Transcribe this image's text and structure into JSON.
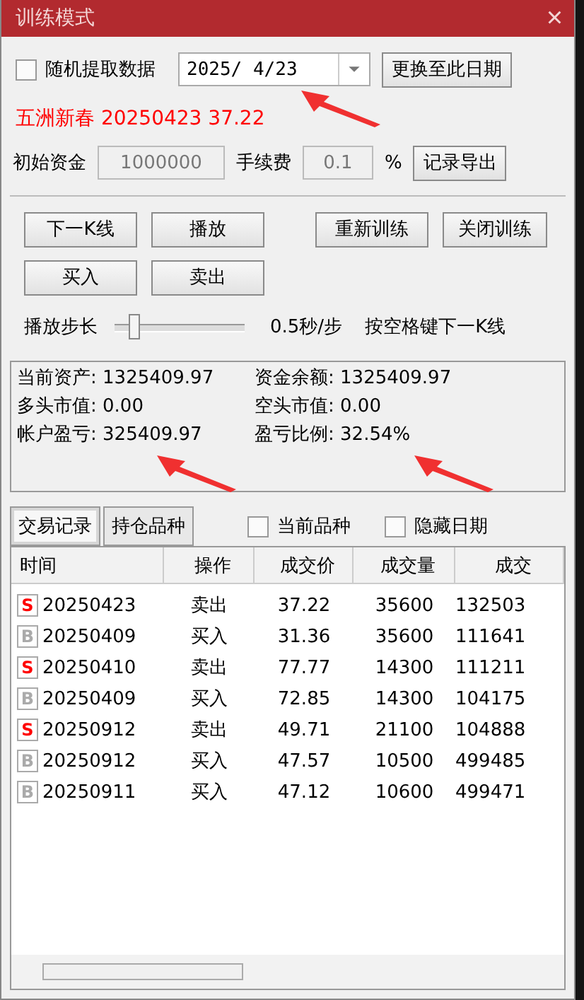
{
  "window": {
    "title": "训练模式",
    "close": "×"
  },
  "random_data": {
    "label": "随机提取数据",
    "checked": false
  },
  "date_field": {
    "value": "2025/ 4/23"
  },
  "change_date_button": "更换至此日期",
  "stock_line": "五洲新春 20250423 37.22",
  "initial_funds": {
    "label": "初始资金",
    "value": "1000000",
    "disabled": true
  },
  "fee": {
    "label": "手续费",
    "value": "0.1",
    "unit": "%",
    "disabled": true
  },
  "export_button": "记录导出",
  "buttons_row1": [
    "下一K线",
    "播放",
    "重新训练",
    "关闭训练"
  ],
  "buttons_row2": [
    "买入",
    "卖出"
  ],
  "step": {
    "label": "播放步长",
    "level": 0.15,
    "reading": "0.5秒/步",
    "hint": "按空格键下一K线"
  },
  "stats": [
    {
      "label": "当前资产:",
      "value": "1325409.97"
    },
    {
      "label": "资金余额:",
      "value": "1325409.97"
    },
    {
      "label": "多头市值:",
      "value": "0.00"
    },
    {
      "label": "空头市值:",
      "value": "0.00"
    },
    {
      "label": "帐户盈亏:",
      "value": "325409.97"
    },
    {
      "label": "盈亏比例:",
      "value": "32.54%"
    }
  ],
  "tabs": [
    {
      "label": "交易记录",
      "selected": true
    },
    {
      "label": "持仓品种",
      "selected": false
    }
  ],
  "filters": [
    {
      "label": "当前品种",
      "checked": false
    },
    {
      "label": "隐藏日期",
      "checked": false
    }
  ],
  "table": {
    "columns": [
      "时间",
      "操作",
      "成交价",
      "成交量",
      "成交"
    ],
    "rows": [
      {
        "kind": "sell",
        "badge": "S",
        "cells": [
          "20250423",
          "卖出",
          "37.22",
          "35600",
          "132503"
        ]
      },
      {
        "kind": "buy",
        "badge": "B",
        "cells": [
          "20250409",
          "买入",
          "31.36",
          "35600",
          "111641"
        ]
      },
      {
        "kind": "sell",
        "badge": "S",
        "cells": [
          "20250410",
          "卖出",
          "77.77",
          "14300",
          "111211"
        ]
      },
      {
        "kind": "buy",
        "badge": "B",
        "cells": [
          "20250409",
          "买入",
          "72.85",
          "14300",
          "104175"
        ]
      },
      {
        "kind": "sell",
        "badge": "S",
        "cells": [
          "20250912",
          "卖出",
          "49.71",
          "21100",
          "104888"
        ]
      },
      {
        "kind": "buy",
        "badge": "B",
        "cells": [
          "20250912",
          "买入",
          "47.57",
          "10500",
          "499485"
        ]
      },
      {
        "kind": "buy",
        "badge": "B",
        "cells": [
          "20250911",
          "买入",
          "47.12",
          "10600",
          "499471"
        ]
      }
    ]
  }
}
